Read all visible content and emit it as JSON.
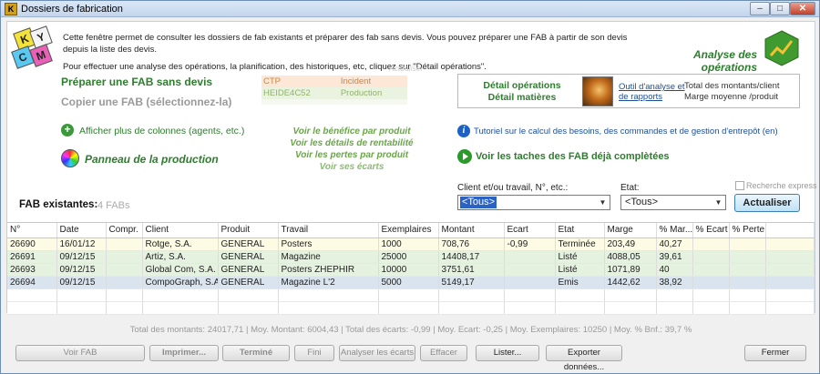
{
  "window": {
    "title": "Dossiers de fabrication",
    "icon_label": "K"
  },
  "logo": {
    "letters": [
      "K",
      "Y",
      "C",
      "M"
    ]
  },
  "intro": {
    "line1": "Cette fenêtre permet de consulter les dossiers de fab existants et préparer des fab sans devis. Vous pouvez préparer une FAB à partir de son devis depuis la liste des devis.",
    "line2": "Pour effectuer une analyse des opérations, la planification, des historiques, etc, cliquez sur \"Détail opérations\"."
  },
  "analyse": {
    "title": "Analyse des opérations"
  },
  "actions": {
    "prepare_fab": "Préparer une FAB sans devis",
    "copy_fab": "Copier une FAB (sélectionnez-la)",
    "actualiser_hint": "Actualiser",
    "more_columns": "Afficher plus de colonnes (agents, etc.)",
    "production_panel": "Panneau de la production"
  },
  "mini_table": [
    {
      "code": "CTP",
      "status": "Incident"
    },
    {
      "code": "HEIDE4C52",
      "status": "Production"
    }
  ],
  "detail": {
    "ops_label": "Détail opérations",
    "materials_label": "Détail matières",
    "tools_link_line1": "Outil d'analyse et",
    "tools_link_line2": "de rapports",
    "right_line1": "Total des montants/client",
    "right_line2": "Marge moyenne /produit"
  },
  "benefits": [
    "Voir le bénéfice par produit",
    "Voir les détails de rentabilité",
    "Voir les pertes par produit",
    "Voir ses écarts"
  ],
  "tutorial": "Tutoriel sur le calcul des besoins, des commandes et de gestion d'entrepôt (en)",
  "taches": "Voir les taches des FAB déjà complètées",
  "filters": {
    "recherche_express": "Recherche express",
    "client_label": "Client et/ou travail, N°, etc.:",
    "client_value": "<Tous>",
    "etat_label": "Etat:",
    "etat_value": "<Tous>",
    "actualiser_button": "Actualiser"
  },
  "fab": {
    "title": "FAB existantes:",
    "count": "4 FABs"
  },
  "grid": {
    "columns": [
      "N°",
      "Date",
      "Compr.",
      "Client",
      "Produit",
      "Travail",
      "Exemplaires",
      "Montant",
      "Ecart",
      "Etat",
      "Marge",
      "% Mar...",
      "% Ecart",
      "% Perte"
    ],
    "rows": [
      {
        "state": "term",
        "cells": [
          "26690",
          "16/01/12",
          "",
          "Rotge, S.A.",
          "GENERAL",
          "Posters",
          "1000",
          "708,76",
          "-0,99",
          "Terminée",
          "203,49",
          "40,27",
          "",
          ""
        ]
      },
      {
        "state": "liste",
        "cells": [
          "26691",
          "09/12/15",
          "",
          "Artiz, S.A.",
          "GENERAL",
          "Magazine",
          "25000",
          "14408,17",
          "",
          "Listé",
          "4088,05",
          "39,61",
          "",
          ""
        ]
      },
      {
        "state": "liste",
        "cells": [
          "26693",
          "09/12/15",
          "",
          "Global Com, S.A.",
          "GENERAL",
          "Posters ZHEPHIR",
          "10000",
          "3751,61",
          "",
          "Listé",
          "1071,89",
          "40",
          "",
          ""
        ]
      },
      {
        "state": "emis",
        "cells": [
          "26694",
          "09/12/15",
          "",
          "CompoGraph, S.A.",
          "GENERAL",
          "Magazine L'2",
          "5000",
          "5149,17",
          "",
          "Emis",
          "1442,62",
          "38,92",
          "",
          ""
        ]
      }
    ]
  },
  "totals": "Total des montants: 24017,71  |  Moy. Montant: 6004,43  |  Total des écarts: -0,99  |  Moy. Ecart: -0,25  |  Moy. Exemplaires: 10250  |  Moy. % Bnf.: 39,7 %",
  "buttons": {
    "voir_fab": "Voir FAB",
    "imprimer": "Imprimer...",
    "termine": "Terminé",
    "fini": "Fini",
    "analyser": "Analyser les écarts",
    "effacer": "Effacer",
    "lister": "Lister...",
    "exporter": "Exporter données...",
    "fermer": "Fermer"
  },
  "colors": {
    "accent_green": "#2e7d2e",
    "link_blue": "#1a4f9a",
    "selection_blue": "#2b63c4"
  }
}
